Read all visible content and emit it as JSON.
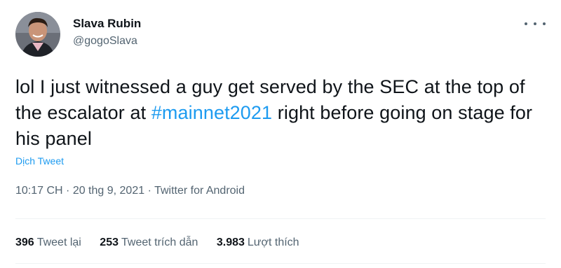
{
  "author": {
    "name": "Slava Rubin",
    "handle": "@gogoSlava"
  },
  "tweet": {
    "text_part1": "lol I just witnessed a guy get served by the SEC at the top of the escalator at ",
    "hashtag": "#mainnet2021",
    "text_part2": " right before going on stage for his panel",
    "translate_label": "Dịch Tweet"
  },
  "meta": {
    "time": "10:17 CH",
    "separator1": " · ",
    "date": "20 thg 9, 2021",
    "separator2": " · ",
    "source": "Twitter for Android"
  },
  "stats": {
    "retweets_count": "396",
    "retweets_label": "Tweet lại",
    "quotes_count": "253",
    "quotes_label": "Tweet trích dẫn",
    "likes_count": "3.983",
    "likes_label": "Lượt thích"
  },
  "icons": {
    "more": "more-horizontal-icon"
  },
  "colors": {
    "accent": "#1d9bf0",
    "text_primary": "#0f1419",
    "text_secondary": "#536471",
    "divider": "#eff3f4"
  }
}
